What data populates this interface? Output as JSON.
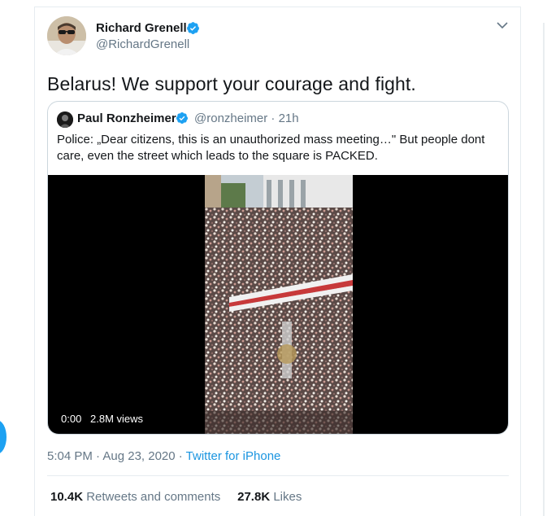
{
  "author": {
    "display_name": "Richard Grenell",
    "handle": "@RichardGrenell",
    "verified": true,
    "verified_icon": "verified-badge-icon"
  },
  "tweet": {
    "text": "Belarus! We support your courage and fight."
  },
  "quoted_tweet": {
    "display_name": "Paul Ronzheimer",
    "handle_time": "@ronzheimer · 21h",
    "verified": true,
    "text": "Police: „Dear citizens, this is an unauthorized mass meeting…\" But people dont care, even the street which leads to the square is PACKED.",
    "video": {
      "time": "0:00",
      "views": "2.8M views"
    }
  },
  "meta": {
    "time_date": "5:04 PM · Aug 23, 2020 · ",
    "source": "Twitter for iPhone"
  },
  "stats": {
    "retweets_count": "10.4K",
    "retweets_label": "Retweets and comments",
    "likes_count": "27.8K",
    "likes_label": "Likes"
  },
  "colors": {
    "accent": "#1da1f2",
    "secondary_text": "#657786",
    "link": "#1b95e0"
  }
}
